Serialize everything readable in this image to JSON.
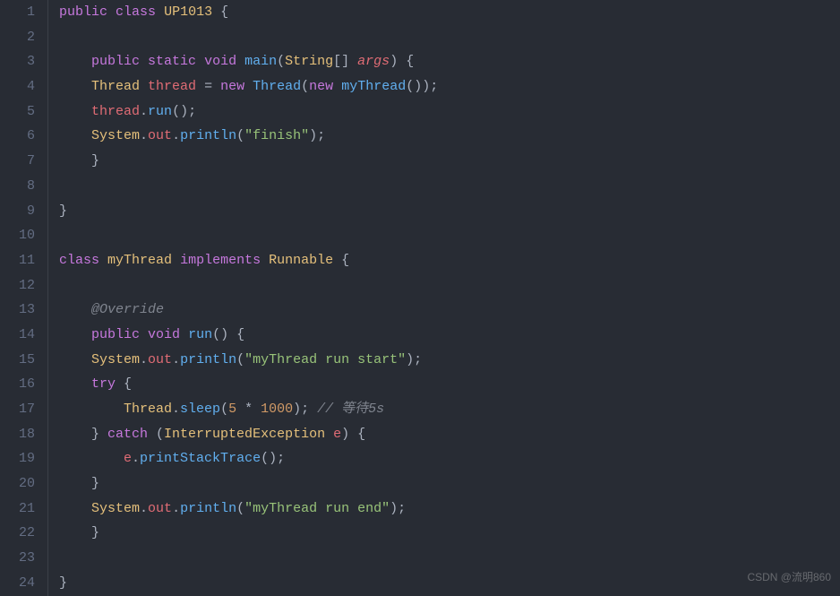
{
  "lineNumbers": [
    "1",
    "2",
    "3",
    "4",
    "5",
    "6",
    "7",
    "8",
    "9",
    "10",
    "11",
    "12",
    "13",
    "14",
    "15",
    "16",
    "17",
    "18",
    "19",
    "20",
    "21",
    "22",
    "23",
    "24"
  ],
  "watermark": "CSDN @流明860",
  "code": {
    "lines": [
      [
        {
          "t": "public",
          "c": "kw"
        },
        {
          "t": " ",
          "c": "punct"
        },
        {
          "t": "class",
          "c": "kw"
        },
        {
          "t": " ",
          "c": "punct"
        },
        {
          "t": "UP1013",
          "c": "type"
        },
        {
          "t": " {",
          "c": "punct"
        }
      ],
      [],
      [
        {
          "t": "    ",
          "c": "punct"
        },
        {
          "t": "public",
          "c": "kw"
        },
        {
          "t": " ",
          "c": "punct"
        },
        {
          "t": "static",
          "c": "kw"
        },
        {
          "t": " ",
          "c": "punct"
        },
        {
          "t": "void",
          "c": "kw"
        },
        {
          "t": " ",
          "c": "punct"
        },
        {
          "t": "main",
          "c": "fn"
        },
        {
          "t": "(",
          "c": "punct"
        },
        {
          "t": "String",
          "c": "type"
        },
        {
          "t": "[] ",
          "c": "punct"
        },
        {
          "t": "args",
          "c": "param"
        },
        {
          "t": ") {",
          "c": "punct"
        }
      ],
      [
        {
          "t": "    ",
          "c": "punct"
        },
        {
          "t": "Thread",
          "c": "type"
        },
        {
          "t": " ",
          "c": "punct"
        },
        {
          "t": "thread",
          "c": "ident"
        },
        {
          "t": " ",
          "c": "punct"
        },
        {
          "t": "=",
          "c": "op"
        },
        {
          "t": " ",
          "c": "punct"
        },
        {
          "t": "new",
          "c": "kw"
        },
        {
          "t": " ",
          "c": "punct"
        },
        {
          "t": "Thread",
          "c": "fn"
        },
        {
          "t": "(",
          "c": "punct"
        },
        {
          "t": "new",
          "c": "kw"
        },
        {
          "t": " ",
          "c": "punct"
        },
        {
          "t": "myThread",
          "c": "fn"
        },
        {
          "t": "());",
          "c": "punct"
        }
      ],
      [
        {
          "t": "    ",
          "c": "punct"
        },
        {
          "t": "thread",
          "c": "ident"
        },
        {
          "t": ".",
          "c": "punct"
        },
        {
          "t": "run",
          "c": "fn"
        },
        {
          "t": "();",
          "c": "punct"
        }
      ],
      [
        {
          "t": "    ",
          "c": "punct"
        },
        {
          "t": "System",
          "c": "type"
        },
        {
          "t": ".",
          "c": "punct"
        },
        {
          "t": "out",
          "c": "ident"
        },
        {
          "t": ".",
          "c": "punct"
        },
        {
          "t": "println",
          "c": "fn"
        },
        {
          "t": "(",
          "c": "punct"
        },
        {
          "t": "\"finish\"",
          "c": "str"
        },
        {
          "t": ");",
          "c": "punct"
        }
      ],
      [
        {
          "t": "    }",
          "c": "punct"
        }
      ],
      [],
      [
        {
          "t": "}",
          "c": "punct"
        }
      ],
      [],
      [
        {
          "t": "class",
          "c": "kw"
        },
        {
          "t": " ",
          "c": "punct"
        },
        {
          "t": "myThread",
          "c": "type"
        },
        {
          "t": " ",
          "c": "punct"
        },
        {
          "t": "implements",
          "c": "kw"
        },
        {
          "t": " ",
          "c": "punct"
        },
        {
          "t": "Runnable",
          "c": "type"
        },
        {
          "t": " {",
          "c": "punct"
        }
      ],
      [],
      [
        {
          "t": "    ",
          "c": "punct"
        },
        {
          "t": "@Override",
          "c": "anno"
        }
      ],
      [
        {
          "t": "    ",
          "c": "punct"
        },
        {
          "t": "public",
          "c": "kw"
        },
        {
          "t": " ",
          "c": "punct"
        },
        {
          "t": "void",
          "c": "kw"
        },
        {
          "t": " ",
          "c": "punct"
        },
        {
          "t": "run",
          "c": "fn"
        },
        {
          "t": "() {",
          "c": "punct"
        }
      ],
      [
        {
          "t": "    ",
          "c": "punct"
        },
        {
          "t": "System",
          "c": "type"
        },
        {
          "t": ".",
          "c": "punct"
        },
        {
          "t": "out",
          "c": "ident"
        },
        {
          "t": ".",
          "c": "punct"
        },
        {
          "t": "println",
          "c": "fn"
        },
        {
          "t": "(",
          "c": "punct"
        },
        {
          "t": "\"myThread run start\"",
          "c": "str"
        },
        {
          "t": ");",
          "c": "punct"
        }
      ],
      [
        {
          "t": "    ",
          "c": "punct"
        },
        {
          "t": "try",
          "c": "kw"
        },
        {
          "t": " {",
          "c": "punct"
        }
      ],
      [
        {
          "t": "        ",
          "c": "punct"
        },
        {
          "t": "Thread",
          "c": "type"
        },
        {
          "t": ".",
          "c": "punct"
        },
        {
          "t": "sleep",
          "c": "fn"
        },
        {
          "t": "(",
          "c": "punct"
        },
        {
          "t": "5",
          "c": "num"
        },
        {
          "t": " ",
          "c": "punct"
        },
        {
          "t": "*",
          "c": "op"
        },
        {
          "t": " ",
          "c": "punct"
        },
        {
          "t": "1000",
          "c": "num"
        },
        {
          "t": "); ",
          "c": "punct"
        },
        {
          "t": "// 等待5s",
          "c": "comment"
        }
      ],
      [
        {
          "t": "    } ",
          "c": "punct"
        },
        {
          "t": "catch",
          "c": "kw"
        },
        {
          "t": " (",
          "c": "punct"
        },
        {
          "t": "InterruptedException",
          "c": "type"
        },
        {
          "t": " ",
          "c": "punct"
        },
        {
          "t": "e",
          "c": "ident"
        },
        {
          "t": ") {",
          "c": "punct"
        }
      ],
      [
        {
          "t": "        ",
          "c": "punct"
        },
        {
          "t": "e",
          "c": "ident"
        },
        {
          "t": ".",
          "c": "punct"
        },
        {
          "t": "printStackTrace",
          "c": "fn"
        },
        {
          "t": "();",
          "c": "punct"
        }
      ],
      [
        {
          "t": "    }",
          "c": "punct"
        }
      ],
      [
        {
          "t": "    ",
          "c": "punct"
        },
        {
          "t": "System",
          "c": "type"
        },
        {
          "t": ".",
          "c": "punct"
        },
        {
          "t": "out",
          "c": "ident"
        },
        {
          "t": ".",
          "c": "punct"
        },
        {
          "t": "println",
          "c": "fn"
        },
        {
          "t": "(",
          "c": "punct"
        },
        {
          "t": "\"myThread run end\"",
          "c": "str"
        },
        {
          "t": ");",
          "c": "punct"
        }
      ],
      [
        {
          "t": "    }",
          "c": "punct"
        }
      ],
      [],
      [
        {
          "t": "}",
          "c": "punct"
        }
      ]
    ]
  }
}
